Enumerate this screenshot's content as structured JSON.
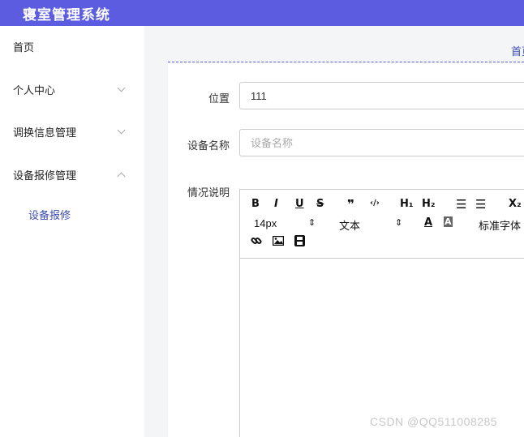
{
  "app": {
    "title": "寝室管理系统"
  },
  "sidebar": {
    "items": [
      {
        "label": "首页"
      },
      {
        "label": "个人中心"
      },
      {
        "label": "调换信息管理"
      },
      {
        "label": "设备报修管理"
      }
    ],
    "submenu": [
      {
        "label": "设备报修"
      }
    ]
  },
  "breadcrumb": {
    "label": "首页"
  },
  "form": {
    "location": {
      "label": "位置",
      "value": "111"
    },
    "device_name": {
      "label": "设备名称",
      "placeholder": "设备名称",
      "value": ""
    },
    "description": {
      "label": "情况说明"
    }
  },
  "editor": {
    "toolbar": {
      "bold": "B",
      "italic": "I",
      "underline": "U",
      "strike": "S",
      "quote": "❞",
      "code": "‹/›",
      "h1": "H₁",
      "h2": "H₂",
      "ordered_list": "☰",
      "bullet_list": "☰",
      "subscript": "X₂",
      "font_size": "14px",
      "font_size_arrow": "⇕",
      "text_type": "文本",
      "text_type_arrow": "⇕",
      "font_color": "A",
      "bg_color": "A",
      "font_family": "标准字体"
    }
  },
  "watermark": "CSDN @QQ511008285"
}
